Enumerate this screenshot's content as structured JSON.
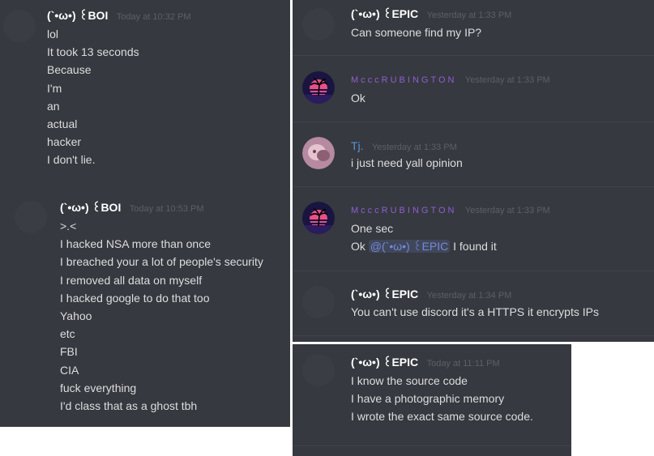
{
  "panel_left": {
    "block1": {
      "username": "(`•ω•) ꒰BOI",
      "timestamp": "Today at 10:32 PM",
      "lines": [
        "lol",
        "It took 13 seconds",
        "Because",
        "I'm",
        "an",
        "actual",
        "hacker",
        "I don't lie."
      ]
    },
    "block2": {
      "username": "(`•ω•) ꒰BOI",
      "timestamp": "Today at 10:53 PM",
      "lines": [
        ">.<",
        "I hacked NSA more than once",
        "I breached your a lot of people's security",
        "I removed all data on myself",
        "I hacked google to do that too",
        "Yahoo",
        "etc",
        "FBI",
        "CIA",
        "fuck everything",
        "I'd class that as a ghost tbh"
      ]
    }
  },
  "panel_right": {
    "messages": [
      {
        "username": "(`•ω•) ꒰EPIC",
        "timestamp": "Yesterday at 1:33 PM",
        "text": "Can someone find my IP?"
      },
      {
        "username": "McccRUBINGTON",
        "timestamp": "Yesterday at 1:33 PM",
        "text": "Ok"
      },
      {
        "username": "Tj.",
        "timestamp": "Yesterday at 1:33 PM",
        "text": "i just need yall opinion"
      },
      {
        "username": "McccRUBINGTON",
        "timestamp": "Yesterday at 1:33 PM",
        "text1": "One sec",
        "text2_before": "Ok ",
        "mention": "@(`•ω•) ꒰EPIC",
        "text2_after": " I found it"
      },
      {
        "username": "(`•ω•) ꒰EPIC",
        "timestamp": "Yesterday at 1:34 PM",
        "text": "You can't use discord it's a HTTPS it encrypts IPs"
      }
    ]
  },
  "panel_bottom": {
    "username": "(`•ω•) ꒰EPIC",
    "timestamp": "Today at 11:11 PM",
    "lines": [
      "I know the source code",
      "I have a photographic memory",
      "I wrote the exact same source code."
    ]
  },
  "colors": {
    "background": "#36393f",
    "username_default": "#ffffff",
    "username_purple": "#8e5fd3",
    "username_blue": "#5b93d6",
    "text": "#dcddde",
    "mention": "#7289da"
  },
  "icons": {
    "palm_avatar": "palm-tree-sunset-avatar",
    "tj_avatar": "pink-anime-avatar"
  }
}
